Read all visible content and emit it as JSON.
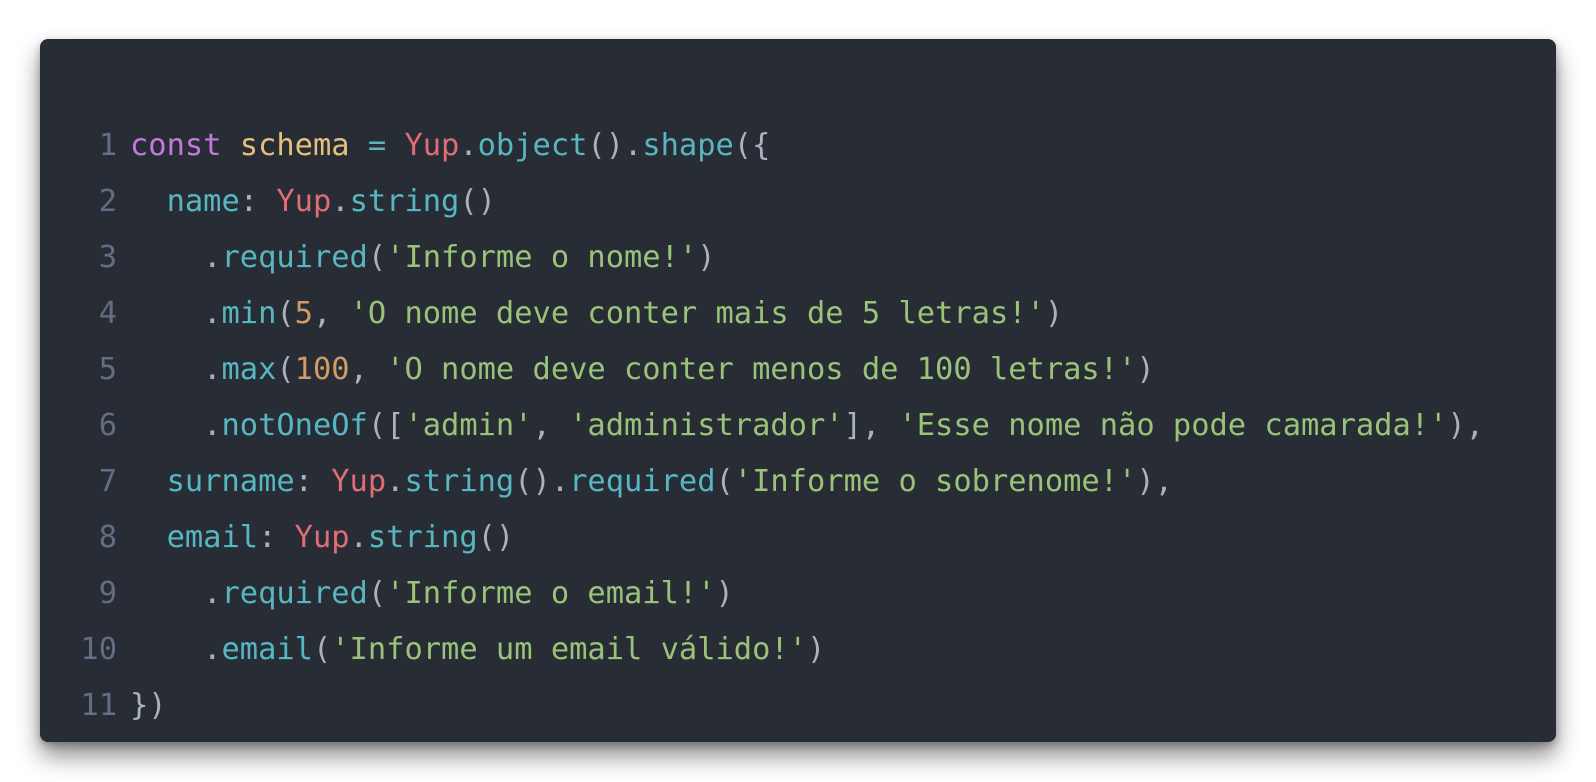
{
  "colors": {
    "background": "#282c34",
    "line_number": "#636d83",
    "keyword": "#c678dd",
    "variable": "#e5c07b",
    "object": "#e06c75",
    "function": "#56b6c2",
    "string": "#98c379",
    "number": "#d19a66",
    "punctuation": "#abb2bf"
  },
  "language": "javascript",
  "lines": [
    {
      "number": "1",
      "tokens": [
        {
          "t": "kw",
          "v": "const"
        },
        {
          "t": "pun",
          "v": " "
        },
        {
          "t": "var",
          "v": "schema"
        },
        {
          "t": "pun",
          "v": " "
        },
        {
          "t": "op",
          "v": "="
        },
        {
          "t": "pun",
          "v": " "
        },
        {
          "t": "obj",
          "v": "Yup"
        },
        {
          "t": "pun",
          "v": "."
        },
        {
          "t": "fn",
          "v": "object"
        },
        {
          "t": "pun",
          "v": "()."
        },
        {
          "t": "fn",
          "v": "shape"
        },
        {
          "t": "pun",
          "v": "({"
        }
      ]
    },
    {
      "number": "2",
      "tokens": [
        {
          "t": "pun",
          "v": "  "
        },
        {
          "t": "prop",
          "v": "name"
        },
        {
          "t": "pun",
          "v": ": "
        },
        {
          "t": "obj",
          "v": "Yup"
        },
        {
          "t": "pun",
          "v": "."
        },
        {
          "t": "fn",
          "v": "string"
        },
        {
          "t": "pun",
          "v": "()"
        }
      ]
    },
    {
      "number": "3",
      "tokens": [
        {
          "t": "pun",
          "v": "    ."
        },
        {
          "t": "fn",
          "v": "required"
        },
        {
          "t": "pun",
          "v": "("
        },
        {
          "t": "str",
          "v": "'Informe o nome!'"
        },
        {
          "t": "pun",
          "v": ")"
        }
      ]
    },
    {
      "number": "4",
      "tokens": [
        {
          "t": "pun",
          "v": "    ."
        },
        {
          "t": "fn",
          "v": "min"
        },
        {
          "t": "pun",
          "v": "("
        },
        {
          "t": "num",
          "v": "5"
        },
        {
          "t": "pun",
          "v": ", "
        },
        {
          "t": "str",
          "v": "'O nome deve conter mais de 5 letras!'"
        },
        {
          "t": "pun",
          "v": ")"
        }
      ]
    },
    {
      "number": "5",
      "tokens": [
        {
          "t": "pun",
          "v": "    ."
        },
        {
          "t": "fn",
          "v": "max"
        },
        {
          "t": "pun",
          "v": "("
        },
        {
          "t": "num",
          "v": "100"
        },
        {
          "t": "pun",
          "v": ", "
        },
        {
          "t": "str",
          "v": "'O nome deve conter menos de 100 letras!'"
        },
        {
          "t": "pun",
          "v": ")"
        }
      ]
    },
    {
      "number": "6",
      "tokens": [
        {
          "t": "pun",
          "v": "    ."
        },
        {
          "t": "fn",
          "v": "notOneOf"
        },
        {
          "t": "pun",
          "v": "(["
        },
        {
          "t": "str",
          "v": "'admin'"
        },
        {
          "t": "pun",
          "v": ", "
        },
        {
          "t": "str",
          "v": "'administrador'"
        },
        {
          "t": "pun",
          "v": "], "
        },
        {
          "t": "str",
          "v": "'Esse nome não pode camarada!'"
        },
        {
          "t": "pun",
          "v": "),"
        }
      ]
    },
    {
      "number": "7",
      "tokens": [
        {
          "t": "pun",
          "v": "  "
        },
        {
          "t": "prop",
          "v": "surname"
        },
        {
          "t": "pun",
          "v": ": "
        },
        {
          "t": "obj",
          "v": "Yup"
        },
        {
          "t": "pun",
          "v": "."
        },
        {
          "t": "fn",
          "v": "string"
        },
        {
          "t": "pun",
          "v": "()."
        },
        {
          "t": "fn",
          "v": "required"
        },
        {
          "t": "pun",
          "v": "("
        },
        {
          "t": "str",
          "v": "'Informe o sobrenome!'"
        },
        {
          "t": "pun",
          "v": "),"
        }
      ]
    },
    {
      "number": "8",
      "tokens": [
        {
          "t": "pun",
          "v": "  "
        },
        {
          "t": "prop",
          "v": "email"
        },
        {
          "t": "pun",
          "v": ": "
        },
        {
          "t": "obj",
          "v": "Yup"
        },
        {
          "t": "pun",
          "v": "."
        },
        {
          "t": "fn",
          "v": "string"
        },
        {
          "t": "pun",
          "v": "()"
        }
      ]
    },
    {
      "number": "9",
      "tokens": [
        {
          "t": "pun",
          "v": "    ."
        },
        {
          "t": "fn",
          "v": "required"
        },
        {
          "t": "pun",
          "v": "("
        },
        {
          "t": "str",
          "v": "'Informe o email!'"
        },
        {
          "t": "pun",
          "v": ")"
        }
      ]
    },
    {
      "number": "10",
      "tokens": [
        {
          "t": "pun",
          "v": "    ."
        },
        {
          "t": "fn",
          "v": "email"
        },
        {
          "t": "pun",
          "v": "("
        },
        {
          "t": "str",
          "v": "'Informe um email válido!'"
        },
        {
          "t": "pun",
          "v": ")"
        }
      ]
    },
    {
      "number": "11",
      "tokens": [
        {
          "t": "pun",
          "v": "})"
        }
      ]
    }
  ]
}
